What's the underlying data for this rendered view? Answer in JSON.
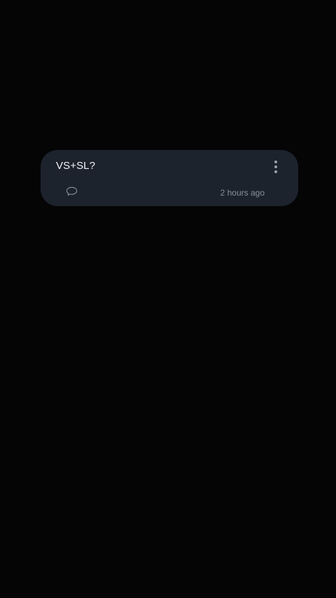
{
  "note": {
    "title": "VS+SL?",
    "timestamp": "2 hours ago"
  },
  "icons": {
    "more": "more-vertical-icon",
    "comment": "comment-icon"
  },
  "colors": {
    "background": "#050506",
    "card": "#1d232d",
    "title_text": "#f1f3f6",
    "secondary_text": "#8a9099"
  }
}
